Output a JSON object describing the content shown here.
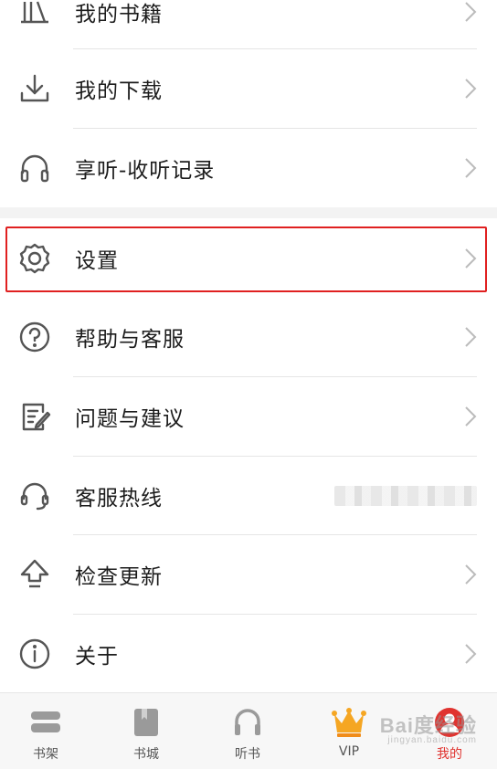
{
  "menu": {
    "items": [
      {
        "label": "我的书籍",
        "icon": "books-icon"
      },
      {
        "label": "我的下载",
        "icon": "download-icon"
      },
      {
        "label": "享听-收听记录",
        "icon": "headphones-icon"
      },
      {
        "label": "设置",
        "icon": "gear-icon"
      },
      {
        "label": "帮助与客服",
        "icon": "help-icon"
      },
      {
        "label": "问题与建议",
        "icon": "feedback-icon"
      },
      {
        "label": "客服热线",
        "icon": "headset-icon"
      },
      {
        "label": "检查更新",
        "icon": "upload-arrow-icon"
      },
      {
        "label": "关于",
        "icon": "info-icon"
      }
    ]
  },
  "tabbar": {
    "tabs": [
      {
        "label": "书架",
        "icon": "bookshelf-icon"
      },
      {
        "label": "书城",
        "icon": "bookstore-icon"
      },
      {
        "label": "听书",
        "icon": "headphones-icon"
      },
      {
        "label": "VIP",
        "icon": "crown-icon"
      },
      {
        "label": "我的",
        "icon": "avatar-icon",
        "active": true
      }
    ]
  },
  "watermark": {
    "text": "Bai度经验",
    "sub": "jingyan.baidu.com"
  },
  "colors": {
    "highlight": "#e02020",
    "active_tab": "#e0332f",
    "crown": "#f5a623"
  }
}
